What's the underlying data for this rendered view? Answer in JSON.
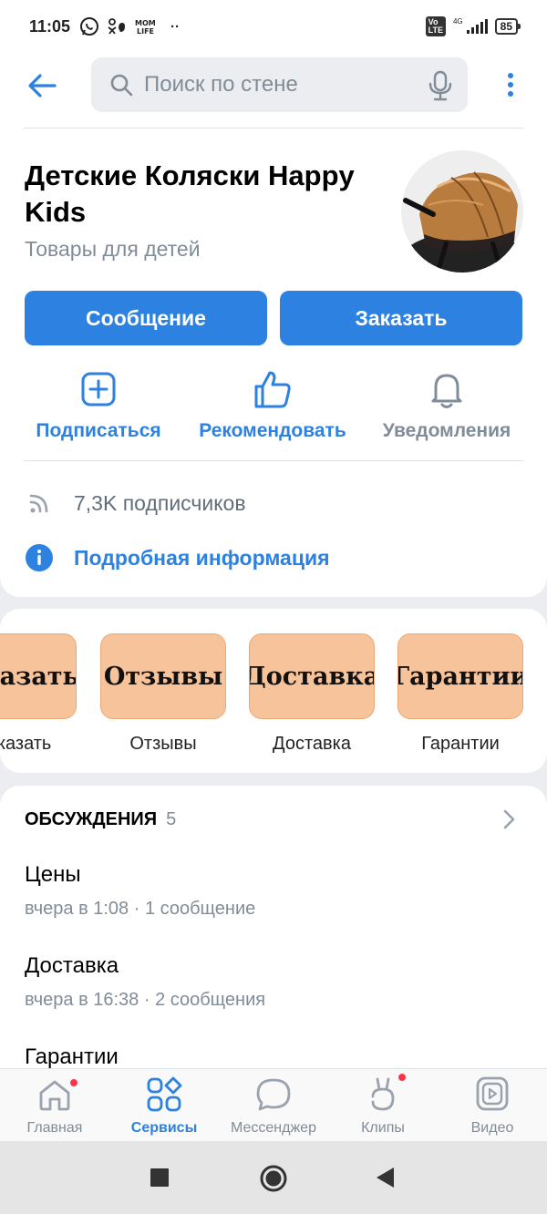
{
  "status_bar": {
    "time": "11:05",
    "app_icons": [
      "whatsapp-icon",
      "odnoklassniki-icon",
      "momlife-icon",
      "more-dots-icon"
    ],
    "momlife_text": "MOM LIFE",
    "volte": "Vo LTE",
    "network": "4G",
    "battery": "85"
  },
  "header": {
    "search_placeholder": "Поиск по стене"
  },
  "group": {
    "title": "Детские Коляски Happy Kids",
    "category": "Товары для детей"
  },
  "buttons": {
    "message": "Сообщение",
    "order": "Заказать"
  },
  "actions": {
    "subscribe": "Подписаться",
    "recommend": "Рекомендовать",
    "notifications": "Уведомления"
  },
  "info": {
    "subscribers": "7,3K подписчиков",
    "details": "Подробная информация"
  },
  "menu": {
    "items": [
      {
        "tile": "Заказать",
        "label": "Заказать"
      },
      {
        "tile": "Отзывы",
        "label": "Отзывы"
      },
      {
        "tile": "Доставка",
        "label": "Доставка"
      },
      {
        "tile": "Гарантии",
        "label": "Гарантии"
      }
    ]
  },
  "discussions": {
    "header": "ОБСУЖДЕНИЯ",
    "count": "5",
    "items": [
      {
        "title": "Цены",
        "meta": "вчера в 1:08 · 1 сообщение"
      },
      {
        "title": "Доставка",
        "meta": "вчера в 16:38 · 2 сообщения"
      },
      {
        "title": "Гарантии",
        "meta": ""
      }
    ]
  },
  "tabbar": {
    "items": [
      {
        "label": "Главная",
        "icon": "home-icon",
        "active": false,
        "badge": true
      },
      {
        "label": "Сервисы",
        "icon": "services-icon",
        "active": true,
        "badge": false
      },
      {
        "label": "Мессенджер",
        "icon": "messenger-icon",
        "active": false,
        "badge": false
      },
      {
        "label": "Клипы",
        "icon": "clips-icon",
        "active": false,
        "badge": true
      },
      {
        "label": "Видео",
        "icon": "video-icon",
        "active": false,
        "badge": false
      }
    ]
  },
  "colors": {
    "accent": "#2d81e0",
    "secondary_text": "#818c99",
    "tile_bg": "#f7c39a",
    "badge": "#ff3347"
  }
}
